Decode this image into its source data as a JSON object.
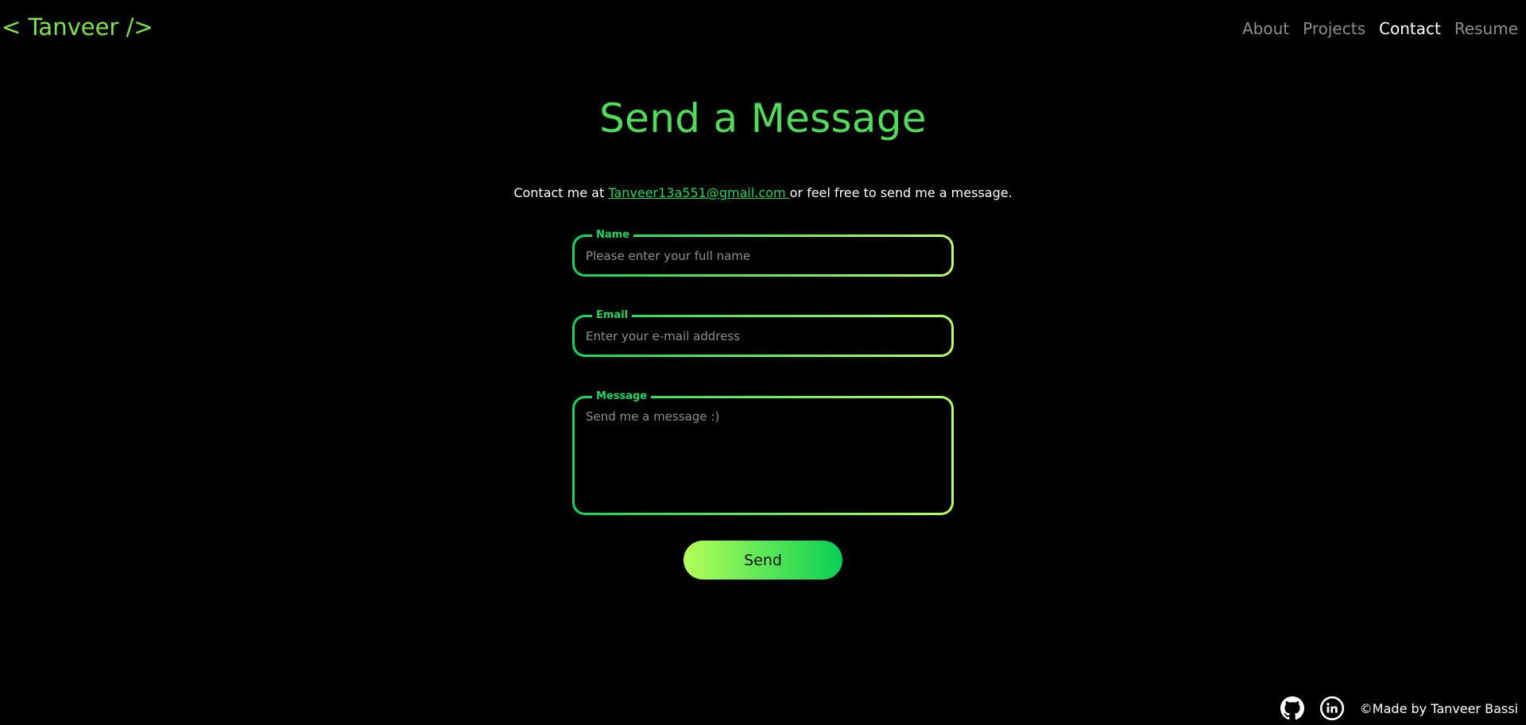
{
  "header": {
    "logo": "< Tanveer />",
    "nav": [
      "About",
      "Projects",
      "Contact",
      "Resume"
    ],
    "active": "Contact"
  },
  "main": {
    "title": "Send a Message",
    "intro_before": "Contact me at ",
    "intro_email": "Tanveer13a551@gmail.com ",
    "intro_after": "or feel free to send me a message."
  },
  "form": {
    "name": {
      "label": "Name",
      "placeholder": "Please enter your full name",
      "value": ""
    },
    "email": {
      "label": "Email",
      "placeholder": "Enter your e-mail address",
      "value": ""
    },
    "message": {
      "label": "Message",
      "placeholder": "Send me a message :)",
      "value": ""
    },
    "send_label": "Send"
  },
  "footer": {
    "icons": [
      "github-icon",
      "linkedin-icon"
    ],
    "copyright": "©Made by Tanveer Bassi"
  },
  "colors": {
    "accent": "#4fdc57",
    "link": "#1ed760",
    "gradient_start": "#12d65a",
    "gradient_end": "#b7ff5c"
  }
}
